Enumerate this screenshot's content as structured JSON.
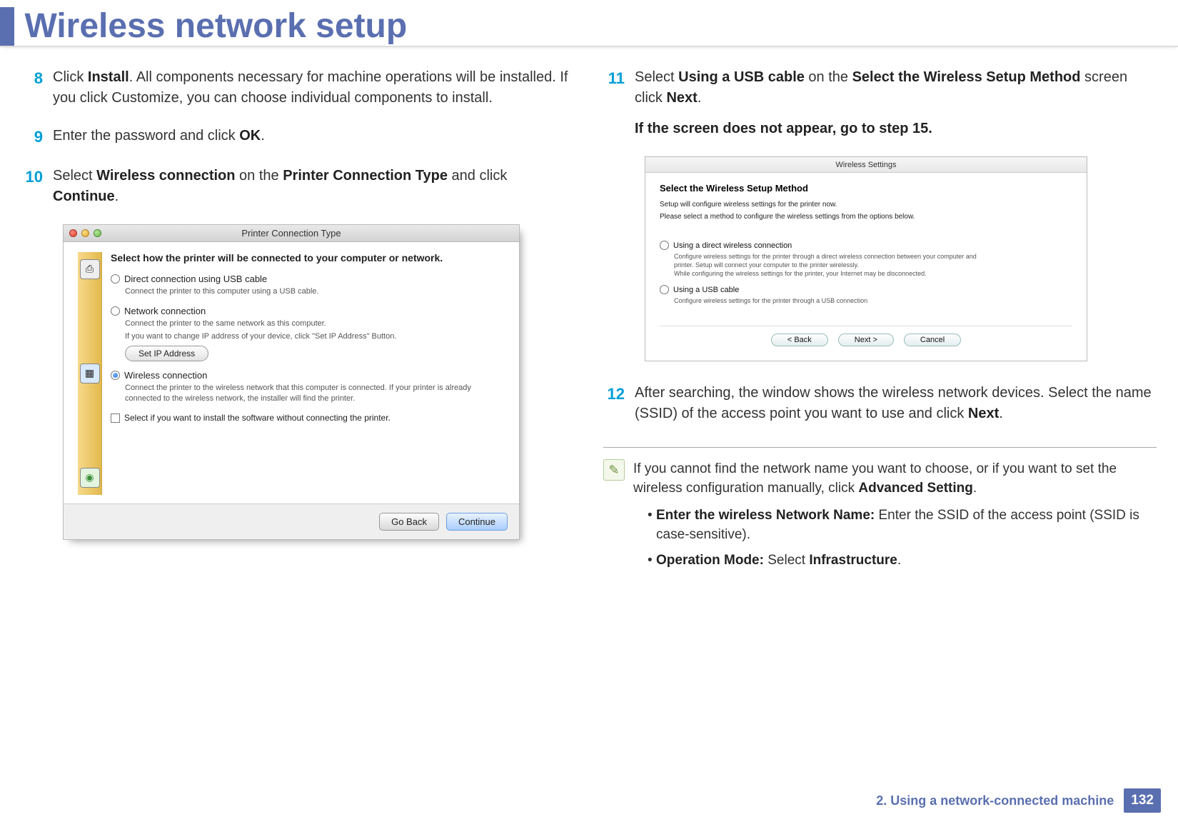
{
  "header": {
    "title": "Wireless network setup"
  },
  "steps": {
    "s8": {
      "num": "8",
      "pre": "Click ",
      "b1": "Install",
      "post": ". All components necessary for machine operations will be installed. If you click Customize, you can choose individual components to install."
    },
    "s9": {
      "num": "9",
      "pre": "Enter the password and click ",
      "b1": "OK",
      "post": "."
    },
    "s10": {
      "num": "10",
      "pre": "Select ",
      "b1": "Wireless connection",
      "mid": " on the ",
      "b2": "Printer Connection Type",
      "mid2": " and click ",
      "b3": "Continue",
      "post2": "."
    },
    "s11": {
      "num": "11",
      "pre": "Select ",
      "b1": "Using a USB cable",
      "mid": " on the ",
      "b2": "Select the Wireless Setup Method",
      "mid2": " screen click ",
      "b3": "Next",
      "post2": ".",
      "sub": "If the screen does not appear, go to step 15."
    },
    "s12": {
      "num": "12",
      "pre": "After searching, the window shows the wireless network devices. Select the name (SSID) of the access point you want to use and click ",
      "b1": "Next",
      "post": "."
    }
  },
  "dlg1": {
    "title": "Printer Connection Type",
    "heading": "Select how the printer will be connected to your computer or network.",
    "opt1": {
      "label": "Direct connection using USB cable",
      "desc": "Connect the printer to this computer using a USB cable."
    },
    "opt2": {
      "label": "Network connection",
      "desc1": "Connect the printer to the same network as this computer.",
      "desc2": "If you want to change IP address of your device, click \"Set IP Address\" Button."
    },
    "setip": "Set IP Address",
    "opt3": {
      "label": "Wireless connection",
      "desc": "Connect the printer to the wireless network that this computer is connected. If your printer is already connected to the wireless network, the installer will find the printer."
    },
    "chk": "Select if you want to install the software without connecting the printer.",
    "back": "Go Back",
    "cont": "Continue"
  },
  "dlg2": {
    "title": "Wireless Settings",
    "heading": "Select the Wireless Setup Method",
    "line1": "Setup will configure wireless settings for the printer now.",
    "line2": "Please select a method to configure the wireless settings from the options below.",
    "opt1": {
      "label": "Using a direct wireless connection",
      "desc": "Configure wireless settings for the printer through a direct wireless connection between your computer and printer. Setup will connect your computer to the printer wirelessly.\nWhile configuring the wireless settings for the printer, your Internet may be disconnected."
    },
    "opt2": {
      "label": "Using a USB cable",
      "desc": "Configure wireless settings for the printer through a USB connection"
    },
    "back": "< Back",
    "next": "Next >",
    "cancel": "Cancel"
  },
  "note": {
    "lead": "If you cannot find the network name you want to choose, or if you want to set the wireless configuration manually, click ",
    "lead_b": "Advanced Setting",
    "lead_post": ".",
    "li1_b": "Enter the wireless Network Name:",
    "li1_t": " Enter the SSID of the access point (SSID is case-sensitive).",
    "li2_b": "Operation Mode:",
    "li2_t": " Select ",
    "li2_b2": "Infrastructure",
    "li2_post": "."
  },
  "footer": {
    "chapter": "2.  Using a network-connected machine",
    "page": "132"
  }
}
